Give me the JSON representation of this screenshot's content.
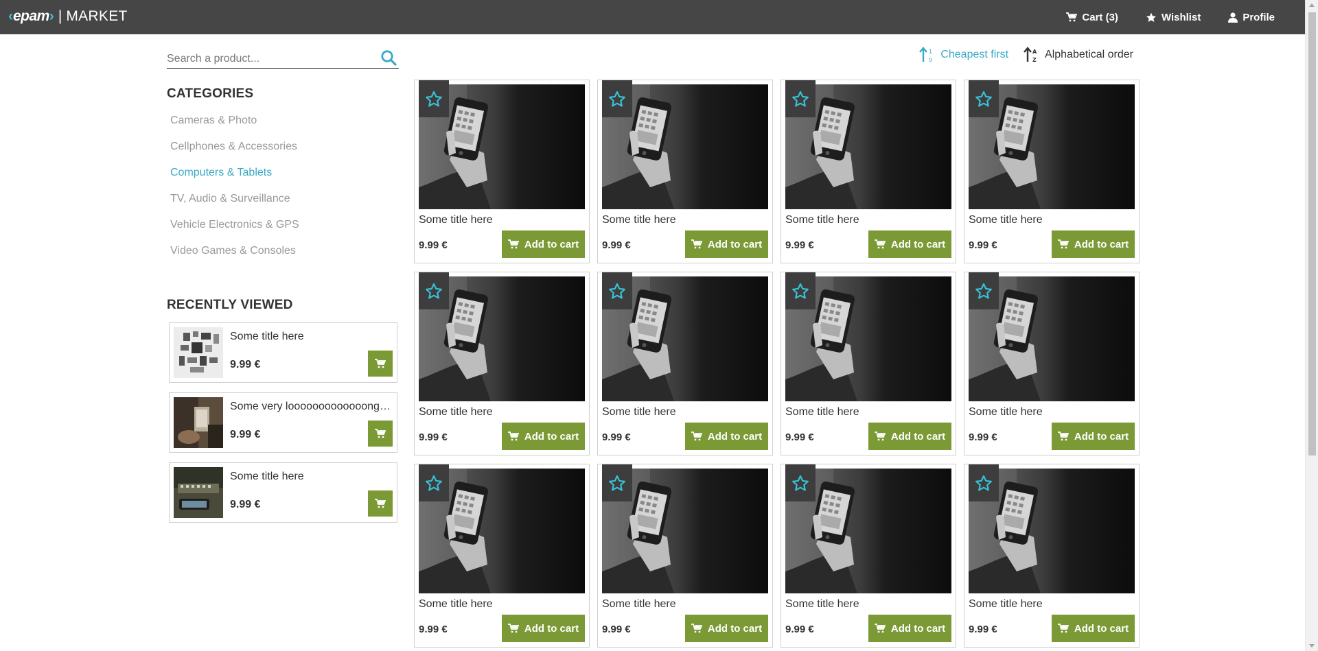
{
  "header": {
    "brand": "epam",
    "separator": "|",
    "app_name": "MARKET",
    "nav": [
      {
        "label": "Cart (3)",
        "icon": "cart-icon"
      },
      {
        "label": "Wishlist",
        "icon": "star-icon"
      },
      {
        "label": "Profile",
        "icon": "user-icon"
      }
    ]
  },
  "search": {
    "placeholder": "Search a product...",
    "value": ""
  },
  "categories": {
    "title": "CATEGORIES",
    "items": [
      {
        "label": "Cameras & Photo",
        "active": false
      },
      {
        "label": "Cellphones & Accessories",
        "active": false
      },
      {
        "label": "Computers & Tablets",
        "active": true
      },
      {
        "label": "TV, Audio & Surveillance",
        "active": false
      },
      {
        "label": "Vehicle Electronics & GPS",
        "active": false
      },
      {
        "label": "Video Games & Consoles",
        "active": false
      }
    ]
  },
  "recently_viewed": {
    "title": "RECENTLY VIEWED",
    "items": [
      {
        "name": "Some title here",
        "price": "9.99 €"
      },
      {
        "name": "Some very looooooooooooong title here",
        "price": "9.99 €"
      },
      {
        "name": "Some title here",
        "price": "9.99 €"
      }
    ]
  },
  "sort": {
    "options": [
      {
        "label": "Cheapest first",
        "active": true
      },
      {
        "label": "Alphabetical order",
        "active": false
      }
    ]
  },
  "products": {
    "add_to_cart_label": "Add to cart",
    "items": [
      {
        "title": "Some title here",
        "price": "9.99 €"
      },
      {
        "title": "Some title here",
        "price": "9.99 €"
      },
      {
        "title": "Some title here",
        "price": "9.99 €"
      },
      {
        "title": "Some title here",
        "price": "9.99 €"
      },
      {
        "title": "Some title here",
        "price": "9.99 €"
      },
      {
        "title": "Some title here",
        "price": "9.99 €"
      },
      {
        "title": "Some title here",
        "price": "9.99 €"
      },
      {
        "title": "Some title here",
        "price": "9.99 €"
      },
      {
        "title": "Some title here",
        "price": "9.99 €"
      },
      {
        "title": "Some title here",
        "price": "9.99 €"
      },
      {
        "title": "Some title here",
        "price": "9.99 €"
      },
      {
        "title": "Some title here",
        "price": "9.99 €"
      }
    ]
  },
  "colors": {
    "header_bg": "#464646",
    "accent": "#39a9c7",
    "button": "#7b9a35",
    "wishlist_badge": "#3d3d3d"
  }
}
